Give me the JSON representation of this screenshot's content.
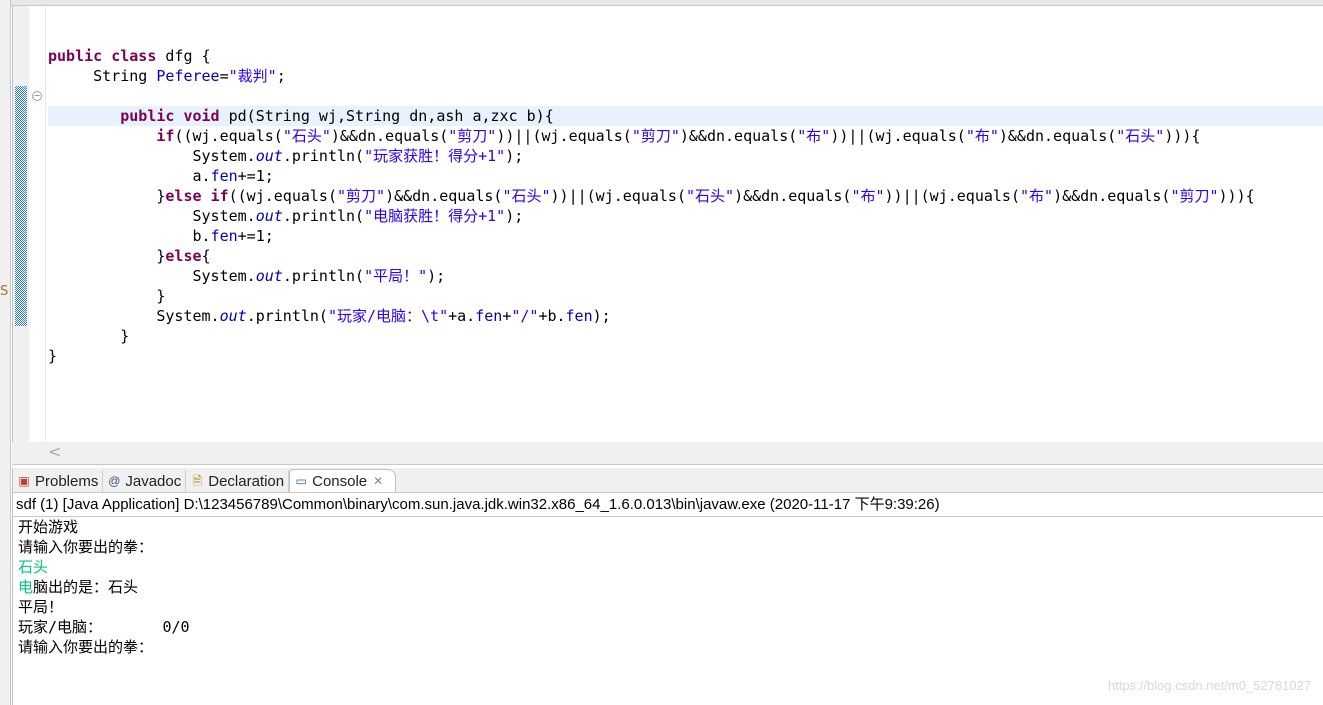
{
  "editor": {
    "code_lines": [
      [],
      [
        [
          "kw",
          "public"
        ],
        [
          "p",
          " "
        ],
        [
          "kw",
          "class"
        ],
        [
          "p",
          " dfg {"
        ]
      ],
      [
        [
          "p",
          "     String "
        ],
        [
          "fld",
          "Peferee"
        ],
        [
          "p",
          "="
        ],
        [
          "st",
          "\"裁判\""
        ],
        [
          "p",
          ";"
        ]
      ],
      [],
      [
        [
          "p",
          "        "
        ],
        [
          "kw",
          "public"
        ],
        [
          "p",
          " "
        ],
        [
          "kw",
          "void"
        ],
        [
          "p",
          " pd(String wj,String dn,ash a,zxc b){"
        ]
      ],
      [
        [
          "p",
          "            "
        ],
        [
          "kw",
          "if"
        ],
        [
          "p",
          "((wj.equals("
        ],
        [
          "st",
          "\"石头\""
        ],
        [
          "p",
          ")&&dn.equals("
        ],
        [
          "st",
          "\"剪刀\""
        ],
        [
          "p",
          "))||(wj.equals("
        ],
        [
          "st",
          "\"剪刀\""
        ],
        [
          "p",
          ")&&dn.equals("
        ],
        [
          "st",
          "\"布\""
        ],
        [
          "p",
          "))||(wj.equals("
        ],
        [
          "st",
          "\"布\""
        ],
        [
          "p",
          ")&&dn.equals("
        ],
        [
          "st",
          "\"石头\""
        ],
        [
          "p",
          "))){"
        ]
      ],
      [
        [
          "p",
          "                System."
        ],
        [
          "sti",
          "out"
        ],
        [
          "p",
          ".println("
        ],
        [
          "st",
          "\"玩家获胜！得分+1\""
        ],
        [
          "p",
          ");"
        ]
      ],
      [
        [
          "p",
          "                a."
        ],
        [
          "fld",
          "fen"
        ],
        [
          "p",
          "+=1;"
        ]
      ],
      [
        [
          "p",
          "            }"
        ],
        [
          "kw",
          "else"
        ],
        [
          "p",
          " "
        ],
        [
          "kw",
          "if"
        ],
        [
          "p",
          "((wj.equals("
        ],
        [
          "st",
          "\"剪刀\""
        ],
        [
          "p",
          ")&&dn.equals("
        ],
        [
          "st",
          "\"石头\""
        ],
        [
          "p",
          "))||(wj.equals("
        ],
        [
          "st",
          "\"石头\""
        ],
        [
          "p",
          ")&&dn.equals("
        ],
        [
          "st",
          "\"布\""
        ],
        [
          "p",
          "))||(wj.equals("
        ],
        [
          "st",
          "\"布\""
        ],
        [
          "p",
          ")&&dn.equals("
        ],
        [
          "st",
          "\"剪刀\""
        ],
        [
          "p",
          "))){"
        ]
      ],
      [
        [
          "p",
          "                System."
        ],
        [
          "sti",
          "out"
        ],
        [
          "p",
          ".println("
        ],
        [
          "st",
          "\"电脑获胜！得分+1\""
        ],
        [
          "p",
          ");"
        ]
      ],
      [
        [
          "p",
          "                b."
        ],
        [
          "fld",
          "fen"
        ],
        [
          "p",
          "+=1;"
        ]
      ],
      [
        [
          "p",
          "            }"
        ],
        [
          "kw",
          "else"
        ],
        [
          "p",
          "{"
        ]
      ],
      [
        [
          "p",
          "                System."
        ],
        [
          "sti",
          "out"
        ],
        [
          "p",
          ".println("
        ],
        [
          "st",
          "\"平局！\""
        ],
        [
          "p",
          ");"
        ]
      ],
      [
        [
          "p",
          "            }"
        ]
      ],
      [
        [
          "p",
          "            System."
        ],
        [
          "sti",
          "out"
        ],
        [
          "p",
          ".println("
        ],
        [
          "st",
          "\"玩家/电脑：\\t\""
        ],
        [
          "p",
          "+a."
        ],
        [
          "fld",
          "fen"
        ],
        [
          "p",
          "+"
        ],
        [
          "st",
          "\"/\""
        ],
        [
          "p",
          "+b."
        ],
        [
          "fld",
          "fen"
        ],
        [
          "p",
          ");"
        ]
      ],
      [
        [
          "p",
          "        }"
        ]
      ],
      [
        [
          "p",
          "}"
        ]
      ]
    ],
    "current_line": 4
  },
  "panel": {
    "tabs": [
      {
        "label": "Problems",
        "icon": "problems-icon"
      },
      {
        "label": "Javadoc",
        "icon": "at-icon"
      },
      {
        "label": "Declaration",
        "icon": "declaration-icon"
      },
      {
        "label": "Console",
        "icon": "console-icon",
        "active": true
      }
    ],
    "process": "sdf (1) [Java Application] D:\\123456789\\Common\\binary\\com.sun.java.jdk.win32.x86_64_1.6.0.013\\bin\\javaw.exe (2020-11-17 下午9:39:26)",
    "console_lines": [
      {
        "text": "开始游戏"
      },
      {
        "text": "请输入你要出的拳："
      },
      {
        "text": "石头",
        "input": true
      },
      {
        "prefix_input": "电",
        "text": "脑出的是：石头"
      },
      {
        "text": "平局！"
      },
      {
        "text": "玩家/电脑：\t0/0"
      },
      {
        "text": "请输入你要出的拳："
      }
    ]
  },
  "colors": {
    "keyword": "#7f0055",
    "string": "#2a00ff",
    "field": "#0000c0",
    "console_input": "#00c87d",
    "current_line": "#e8f2fe"
  },
  "watermark": "https://blog.csdn.net/m0_52781027"
}
